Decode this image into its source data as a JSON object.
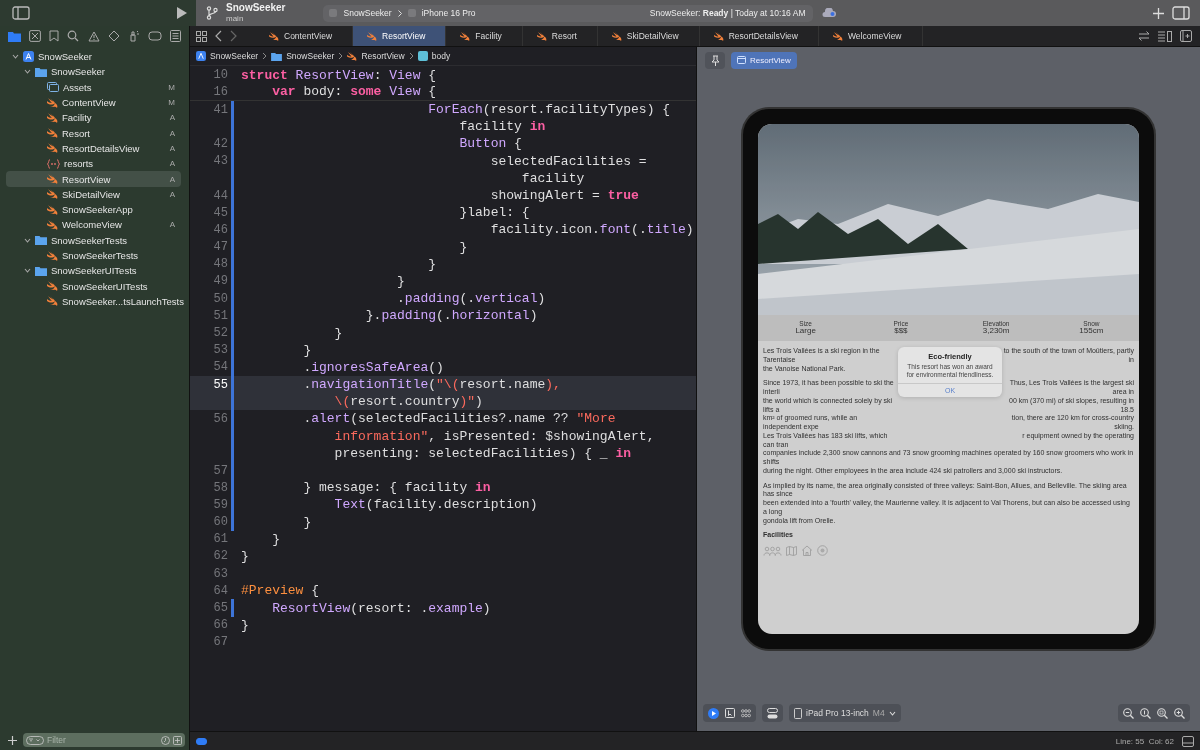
{
  "toolbar": {
    "project": "SnowSeeker",
    "branch": "main",
    "scheme": "SnowSeeker",
    "destination": "iPhone 16 Pro",
    "status": "SnowSeeker: **Ready** | Today at 10:16 AM"
  },
  "navigator": {
    "tree": [
      {
        "label": "SnowSeeker",
        "kind": "project",
        "expanded": true,
        "selected": false,
        "children": [
          {
            "label": "SnowSeeker",
            "kind": "folder",
            "expanded": true,
            "selected": false,
            "children": [
              {
                "label": "Assets",
                "kind": "assets",
                "badge": "M",
                "selected": false
              },
              {
                "label": "ContentView",
                "kind": "swift",
                "badge": "M",
                "selected": false
              },
              {
                "label": "Facility",
                "kind": "swift",
                "badge": "A",
                "selected": false
              },
              {
                "label": "Resort",
                "kind": "swift",
                "badge": "A",
                "selected": false
              },
              {
                "label": "ResortDetailsView",
                "kind": "swift",
                "badge": "A",
                "selected": false
              },
              {
                "label": "resorts",
                "kind": "json",
                "badge": "A",
                "selected": false
              },
              {
                "label": "ResortView",
                "kind": "swift",
                "badge": "A",
                "selected": true
              },
              {
                "label": "SkiDetailView",
                "kind": "swift",
                "badge": "A",
                "selected": false
              },
              {
                "label": "SnowSeekerApp",
                "kind": "swift",
                "selected": false
              },
              {
                "label": "WelcomeView",
                "kind": "swift",
                "badge": "A",
                "selected": false
              }
            ]
          },
          {
            "label": "SnowSeekerTests",
            "kind": "folder",
            "expanded": true,
            "selected": false,
            "children": [
              {
                "label": "SnowSeekerTests",
                "kind": "swift",
                "selected": false
              }
            ]
          },
          {
            "label": "SnowSeekerUITests",
            "kind": "folder",
            "expanded": true,
            "selected": false,
            "children": [
              {
                "label": "SnowSeekerUITests",
                "kind": "swift",
                "selected": false
              },
              {
                "label": "SnowSeeker...tsLaunchTests",
                "kind": "swift",
                "selected": false
              }
            ]
          }
        ]
      }
    ],
    "filter": {
      "placeholder": "Filter"
    }
  },
  "tabs": [
    {
      "label": "ContentView",
      "selected": false
    },
    {
      "label": "ResortView",
      "selected": true
    },
    {
      "label": "Facility",
      "selected": false
    },
    {
      "label": "Resort",
      "selected": false
    },
    {
      "label": "SkiDetailView",
      "selected": false
    },
    {
      "label": "ResortDetailsView",
      "selected": false
    },
    {
      "label": "WelcomeView",
      "selected": false
    }
  ],
  "breadcrumb": [
    {
      "label": "SnowSeeker",
      "kind": "project"
    },
    {
      "label": "SnowSeeker",
      "kind": "folder"
    },
    {
      "label": "ResortView",
      "kind": "swift"
    },
    {
      "label": "body",
      "kind": "property"
    }
  ],
  "code": {
    "sticky": [
      {
        "n": "10",
        "t": [
          {
            "kind": "keyword",
            "text": "struct"
          },
          {
            "kind": "type",
            "text": " ResortView"
          },
          {
            "kind": "plain",
            "text": ": "
          },
          {
            "kind": "type",
            "text": "View"
          },
          {
            "kind": "plain",
            "text": " {"
          }
        ]
      },
      {
        "n": "16",
        "t": [
          {
            "kind": "keyword",
            "text": "    var"
          },
          {
            "kind": "plain",
            "text": " body: "
          },
          {
            "kind": "keyword",
            "text": "some"
          },
          {
            "kind": "type",
            "text": " View"
          },
          {
            "kind": "plain",
            "text": " {"
          }
        ]
      }
    ],
    "rows": [
      {
        "n": "41",
        "changed": true,
        "current": false,
        "t": [
          {
            "kind": "type",
            "text": "                        ForEach"
          },
          {
            "kind": "plain",
            "text": "(resort.facilityTypes) {"
          }
        ]
      },
      {
        "changed": true,
        "current": false,
        "t": [
          {
            "kind": "plain",
            "text": "                            facility "
          },
          {
            "kind": "keyword",
            "text": "in"
          }
        ]
      },
      {
        "n": "42",
        "changed": true,
        "current": false,
        "t": [
          {
            "kind": "type",
            "text": "                            Button"
          },
          {
            "kind": "plain",
            "text": " {"
          }
        ]
      },
      {
        "n": "43",
        "changed": true,
        "current": false,
        "t": [
          {
            "kind": "plain",
            "text": "                                selectedFacilities ="
          }
        ]
      },
      {
        "changed": true,
        "current": false,
        "t": [
          {
            "kind": "plain",
            "text": "                                    facility"
          }
        ]
      },
      {
        "n": "44",
        "changed": true,
        "current": false,
        "t": [
          {
            "kind": "plain",
            "text": "                                showingAlert = "
          },
          {
            "kind": "keyword",
            "text": "true"
          }
        ]
      },
      {
        "n": "45",
        "changed": true,
        "current": false,
        "t": [
          {
            "kind": "plain",
            "text": "                            }label: {"
          }
        ]
      },
      {
        "n": "46",
        "changed": true,
        "current": false,
        "t": [
          {
            "kind": "plain",
            "text": "                                facility.icon."
          },
          {
            "kind": "type",
            "text": "font"
          },
          {
            "kind": "plain",
            "text": "(."
          },
          {
            "kind": "type",
            "text": "title"
          },
          {
            "kind": "plain",
            "text": ")"
          }
        ]
      },
      {
        "n": "47",
        "changed": true,
        "current": false,
        "t": [
          {
            "kind": "plain",
            "text": "                            }"
          }
        ]
      },
      {
        "n": "48",
        "changed": true,
        "current": false,
        "t": [
          {
            "kind": "plain",
            "text": "                        }"
          }
        ]
      },
      {
        "n": "49",
        "changed": true,
        "current": false,
        "t": [
          {
            "kind": "plain",
            "text": "                    }"
          }
        ]
      },
      {
        "n": "50",
        "changed": true,
        "current": false,
        "t": [
          {
            "kind": "plain",
            "text": "                    ."
          },
          {
            "kind": "type",
            "text": "padding"
          },
          {
            "kind": "plain",
            "text": "(."
          },
          {
            "kind": "type",
            "text": "vertical"
          },
          {
            "kind": "plain",
            "text": ")"
          }
        ]
      },
      {
        "n": "51",
        "changed": true,
        "current": false,
        "t": [
          {
            "kind": "plain",
            "text": "                }."
          },
          {
            "kind": "type",
            "text": "padding"
          },
          {
            "kind": "plain",
            "text": "(."
          },
          {
            "kind": "type",
            "text": "horizontal"
          },
          {
            "kind": "plain",
            "text": ")"
          }
        ]
      },
      {
        "n": "52",
        "changed": true,
        "current": false,
        "t": [
          {
            "kind": "plain",
            "text": "            }"
          }
        ]
      },
      {
        "n": "53",
        "changed": true,
        "current": false,
        "t": [
          {
            "kind": "plain",
            "text": "        }"
          }
        ]
      },
      {
        "n": "54",
        "changed": true,
        "current": false,
        "t": [
          {
            "kind": "plain",
            "text": "        ."
          },
          {
            "kind": "type",
            "text": "ignoresSafeArea"
          },
          {
            "kind": "plain",
            "text": "()"
          }
        ]
      },
      {
        "n": "55",
        "changed": true,
        "current": true,
        "t": [
          {
            "kind": "plain",
            "text": "        ."
          },
          {
            "kind": "type",
            "text": "navigationTitle"
          },
          {
            "kind": "plain",
            "text": "("
          },
          {
            "kind": "string",
            "text": "\"\\("
          },
          {
            "kind": "plain",
            "text": "resort.name"
          },
          {
            "kind": "string",
            "text": "),"
          }
        ]
      },
      {
        "changed": true,
        "current": true,
        "t": [
          {
            "kind": "string",
            "text": "            \\("
          },
          {
            "kind": "plain",
            "text": "resort.country"
          },
          {
            "kind": "string",
            "text": ")\""
          },
          {
            "kind": "plain",
            "text": ")"
          }
        ]
      },
      {
        "n": "56",
        "changed": true,
        "current": false,
        "t": [
          {
            "kind": "plain",
            "text": "        ."
          },
          {
            "kind": "type",
            "text": "alert"
          },
          {
            "kind": "plain",
            "text": "(selectedFacilities?.name ?? "
          },
          {
            "kind": "string",
            "text": "\"More"
          }
        ]
      },
      {
        "changed": true,
        "current": false,
        "t": [
          {
            "kind": "string",
            "text": "            information\""
          },
          {
            "kind": "plain",
            "text": ", isPresented: $showingAlert,"
          }
        ]
      },
      {
        "changed": true,
        "current": false,
        "t": [
          {
            "kind": "plain",
            "text": "            presenting: selectedFacilities) { _ "
          },
          {
            "kind": "keyword",
            "text": "in"
          }
        ]
      },
      {
        "n": "57",
        "changed": true,
        "current": false
      },
      {
        "n": "58",
        "changed": true,
        "current": false,
        "t": [
          {
            "kind": "plain",
            "text": "        } message: { facility "
          },
          {
            "kind": "keyword",
            "text": "in"
          }
        ]
      },
      {
        "n": "59",
        "changed": true,
        "current": false,
        "t": [
          {
            "kind": "type",
            "text": "            Text"
          },
          {
            "kind": "plain",
            "text": "(facility.description)"
          }
        ]
      },
      {
        "n": "60",
        "changed": true,
        "current": false,
        "t": [
          {
            "kind": "plain",
            "text": "        }"
          }
        ]
      },
      {
        "n": "61",
        "changed": false,
        "current": false,
        "t": [
          {
            "kind": "plain",
            "text": "    }"
          }
        ]
      },
      {
        "n": "62",
        "changed": false,
        "current": false,
        "t": [
          {
            "kind": "plain",
            "text": "}"
          }
        ]
      },
      {
        "n": "63",
        "changed": false,
        "current": false
      },
      {
        "n": "64",
        "changed": false,
        "current": false,
        "t": [
          {
            "kind": "macro",
            "text": "#Preview"
          },
          {
            "kind": "plain",
            "text": " {"
          }
        ]
      },
      {
        "n": "65",
        "changed": true,
        "current": false,
        "t": [
          {
            "kind": "type",
            "text": "    ResortView"
          },
          {
            "kind": "plain",
            "text": "(resort: ."
          },
          {
            "kind": "type",
            "text": "example"
          },
          {
            "kind": "plain",
            "text": ")"
          }
        ]
      },
      {
        "n": "66",
        "changed": false,
        "current": false,
        "t": [
          {
            "kind": "plain",
            "text": "}"
          }
        ]
      },
      {
        "n": "67",
        "changed": false,
        "current": false
      }
    ]
  },
  "preview": {
    "chips": [
      {
        "label": "ResortView",
        "selected": true
      }
    ],
    "stats": [
      {
        "label": "Size",
        "value": "Large"
      },
      {
        "label": "Price",
        "value": "$$$"
      },
      {
        "label": "Elevation",
        "value": "3,230m"
      },
      {
        "label": "Snow",
        "value": "155cm"
      }
    ],
    "paragraphs": [
      [
        [
          "Les Trois Vallées is a ski region in the Tarentaise",
          "to the south of the town of Moûtiers, partly in"
        ],
        [
          "the Vanoise National Park."
        ]
      ],
      [
        [
          "Since 1973, it has been possible to ski the interli",
          "Thus, Les Trois Vallées is the largest ski area in"
        ],
        [
          "the world which is connected solely by ski lifts a",
          "00 km (370 mi) of ski slopes, resulting in 18.5"
        ],
        [
          "km² of groomed runs, while an independent expe",
          "tion, there are 120 km for cross-country skiing."
        ],
        [
          "Les Trois Vallées has 183 ski lifts, which can tran",
          "r equipment owned by the operating"
        ],
        [
          "companies include 2,300 snow cannons and 73 snow grooming machines operated by 160 snow groomers who work in shifts"
        ],
        [
          "during the night. Other employees in the area include 424 ski patrollers and 3,000 ski instructors."
        ]
      ],
      [
        [
          "As implied by its name, the area originally consisted of three valleys: Saint-Bon, Allues, and Belleville. The skiing area has since"
        ],
        [
          "been extended into a 'fourth' valley, the Maurienne valley. It is adjacent to Val Thorens, but can also be accessed using a long"
        ],
        [
          "gondola lift from Orelle."
        ]
      ]
    ],
    "facilities_title": "Facilities",
    "facilities": [
      {
        "kind": "people"
      },
      {
        "kind": "map"
      },
      {
        "kind": "house"
      },
      {
        "kind": "target"
      }
    ],
    "alert": {
      "title": "Eco-friendly",
      "message": "This resort has won an award for environmental friendliness.",
      "button": "OK"
    },
    "device": {
      "name": "iPad Pro 13-inch",
      "model": "M4"
    },
    "modes": [
      {
        "kind": "live",
        "selected": true
      },
      {
        "kind": "select",
        "selected": false
      },
      {
        "kind": "grid",
        "selected": false
      }
    ]
  },
  "status_bar": {
    "breakpoints_on": true,
    "position": "Line: 55  Col: 62"
  }
}
